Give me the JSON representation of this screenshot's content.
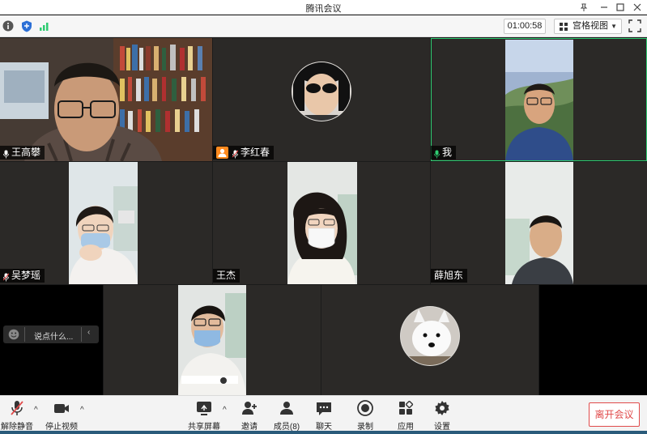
{
  "window": {
    "title": "腾讯会议"
  },
  "infobar": {
    "timer": "01:00:58",
    "view_label": "宫格视图"
  },
  "participants": [
    {
      "name": "王高攀"
    },
    {
      "name": "李红春"
    },
    {
      "name": "我"
    },
    {
      "name": "吴梦瑶"
    },
    {
      "name": "王杰"
    },
    {
      "name": "薛旭东"
    }
  ],
  "chat": {
    "placeholder": "说点什么..."
  },
  "toolbar": {
    "unmute": "解除静音",
    "stop_video": "停止视频",
    "share_screen": "共享屏幕",
    "invite": "邀请",
    "members": "成员(8)",
    "chat": "聊天",
    "record": "录制",
    "apps": "应用",
    "settings": "设置",
    "leave": "离开会议"
  },
  "colors": {
    "accent_green": "#2ecc71",
    "leave_red": "#e04a4a",
    "avatar_orange": "#ff8a1f"
  }
}
